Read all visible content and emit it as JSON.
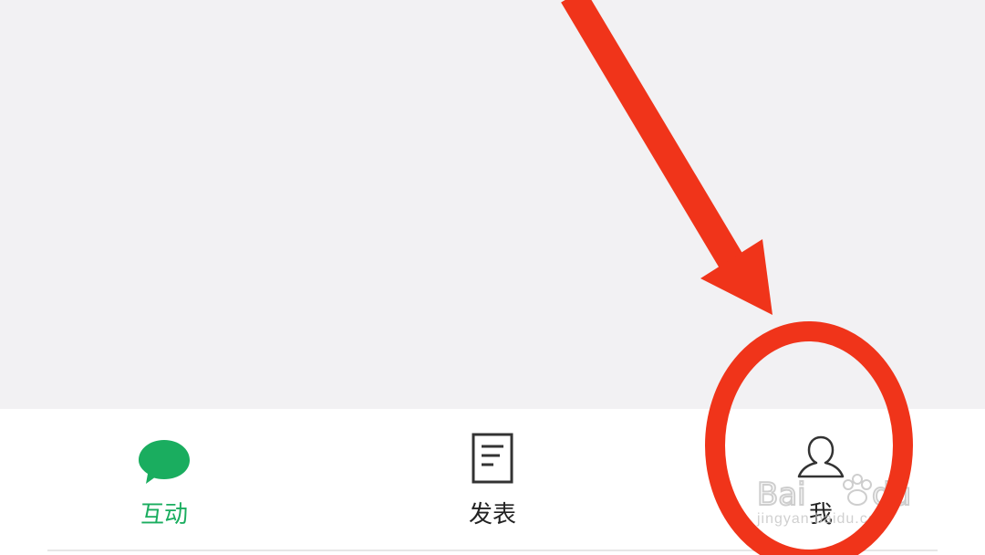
{
  "tabs": [
    {
      "label": "互动",
      "icon": "chat-bubble-icon",
      "active": true
    },
    {
      "label": "发表",
      "icon": "document-icon",
      "active": false
    },
    {
      "label": "我",
      "icon": "person-icon",
      "active": false
    }
  ],
  "colors": {
    "accent": "#1aad5f",
    "annotation": "#f0341a",
    "content_bg": "#f2f1f3"
  },
  "watermark": {
    "url": "jingyan.baidu.com"
  }
}
